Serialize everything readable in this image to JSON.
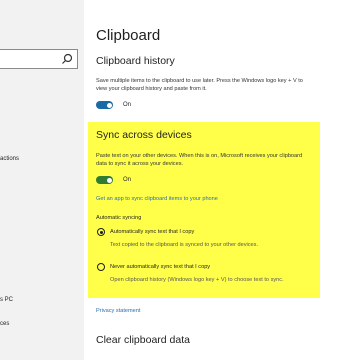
{
  "sidebar": {
    "fragments": [
      "actions",
      "s PC",
      "ces"
    ]
  },
  "page": {
    "title": "Clipboard"
  },
  "clipboard_history": {
    "heading": "Clipboard history",
    "description": "Save multiple items to the clipboard to use later. Press the Windows logo key + V to view your clipboard history and paste from it.",
    "toggle_state": "On"
  },
  "sync": {
    "heading": "Sync across devices",
    "description": "Paste text on your other devices. When this is on, Microsoft receives your clipboard data to sync it across your devices.",
    "toggle_state": "On",
    "app_link": "Get an app to sync clipboard items to your phone",
    "auto_sync_heading": "Automatic syncing",
    "options": [
      {
        "label": "Automatically sync text that I copy",
        "desc": "Text copied to the clipboard is synced to your other devices.",
        "selected": true
      },
      {
        "label": "Never automatically sync text that I copy",
        "desc": "Open clipboard history (Windows logo key + V) to choose text to sync.",
        "selected": false
      }
    ]
  },
  "privacy_link": "Privacy statement",
  "clear_section": {
    "heading": "Clear clipboard data"
  },
  "colors": {
    "highlight": "#ffff4a",
    "toggle_blue": "#1a6aa5",
    "toggle_green": "#2e7d32",
    "link": "#2a6fb0"
  }
}
